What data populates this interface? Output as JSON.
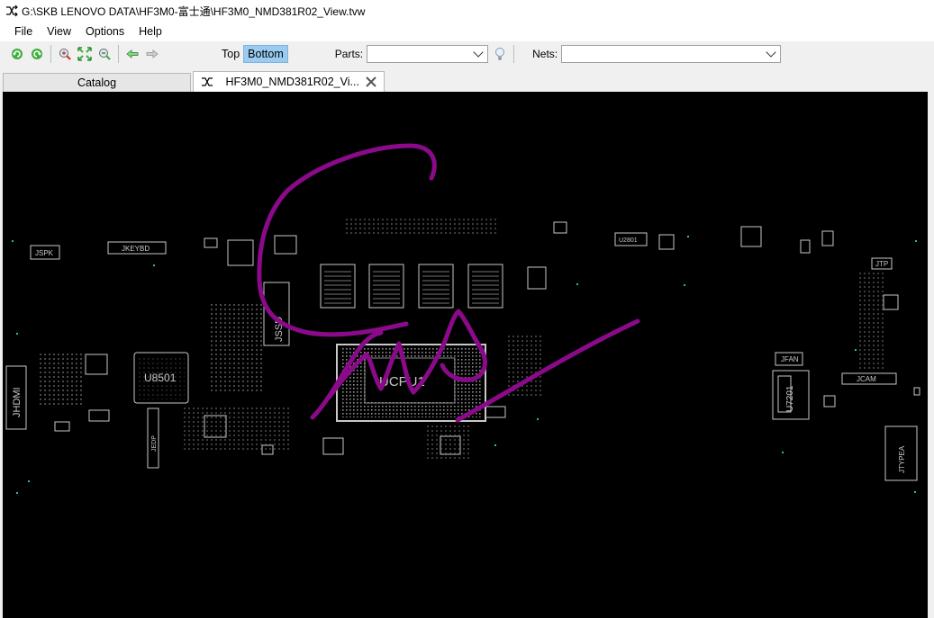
{
  "window": {
    "title": "G:\\SKB LENOVO DATA\\HF3M0-富士通\\HF3M0_NMD381R02_View.tvw"
  },
  "menu": {
    "items": [
      "File",
      "View",
      "Options",
      "Help"
    ]
  },
  "toolbar": {
    "side_top": "Top",
    "side_bottom": "Bottom",
    "active_side": "Bottom",
    "parts_label": "Parts:",
    "parts_value": "",
    "nets_label": "Nets:",
    "nets_value": ""
  },
  "tabs": [
    {
      "label": "Catalog",
      "active": false
    },
    {
      "label": "HF3M0_NMD381R02_Vi...",
      "active": true
    }
  ],
  "board": {
    "labels": {
      "jspk": "JSPK",
      "jkeybd": "JKEYBD",
      "jhdmi": "JHDMI",
      "u8501": "U8501",
      "jssd": "JSSD",
      "ucpu1": "UCPU1",
      "jfan": "JFAN",
      "u7201": "U7201",
      "jcam": "JCAM",
      "jtp": "JTP",
      "jtypea": "JTYPEA",
      "jedp": "JEDP",
      "u2801": "U2801"
    },
    "colors": {
      "outline": "#c8c8c8",
      "ink": "#8a0a8a",
      "background": "#000000",
      "cyan": "#33b3b3"
    }
  }
}
